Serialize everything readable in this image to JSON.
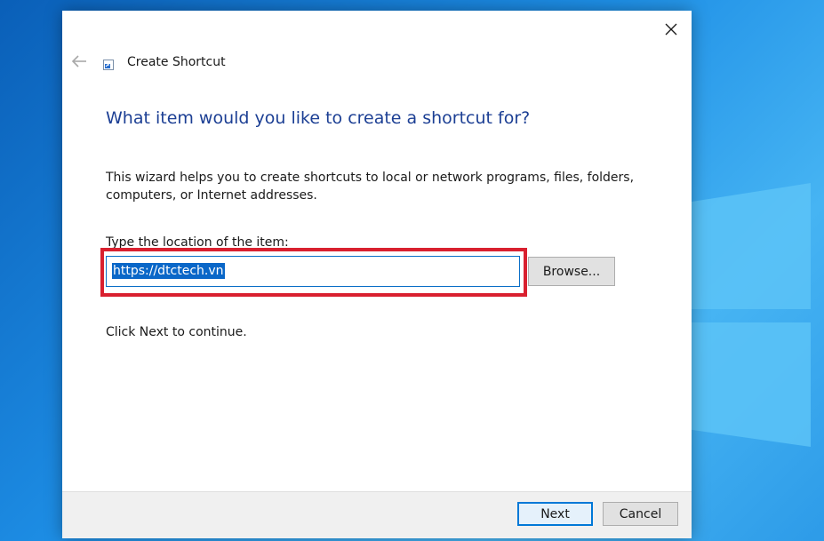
{
  "dialog": {
    "title": "Create Shortcut",
    "heading": "What item would you like to create a shortcut for?",
    "description": "This wizard helps you to create shortcuts to local or network programs, files, folders, computers, or Internet addresses.",
    "location_label": "Type the location of the item:",
    "location_value": "https://dtctech.vn",
    "browse_label": "Browse...",
    "continue_text": "Click Next to continue.",
    "next_label": "Next",
    "cancel_label": "Cancel"
  },
  "icons": {
    "close": "close-icon",
    "back": "back-arrow-icon",
    "app": "shortcut-icon",
    "desktop_logo": "windows-logo-icon"
  },
  "colors": {
    "heading": "#1c3f94",
    "selection": "#0a67c8",
    "highlight": "#d9202f",
    "accent": "#0078d7"
  }
}
